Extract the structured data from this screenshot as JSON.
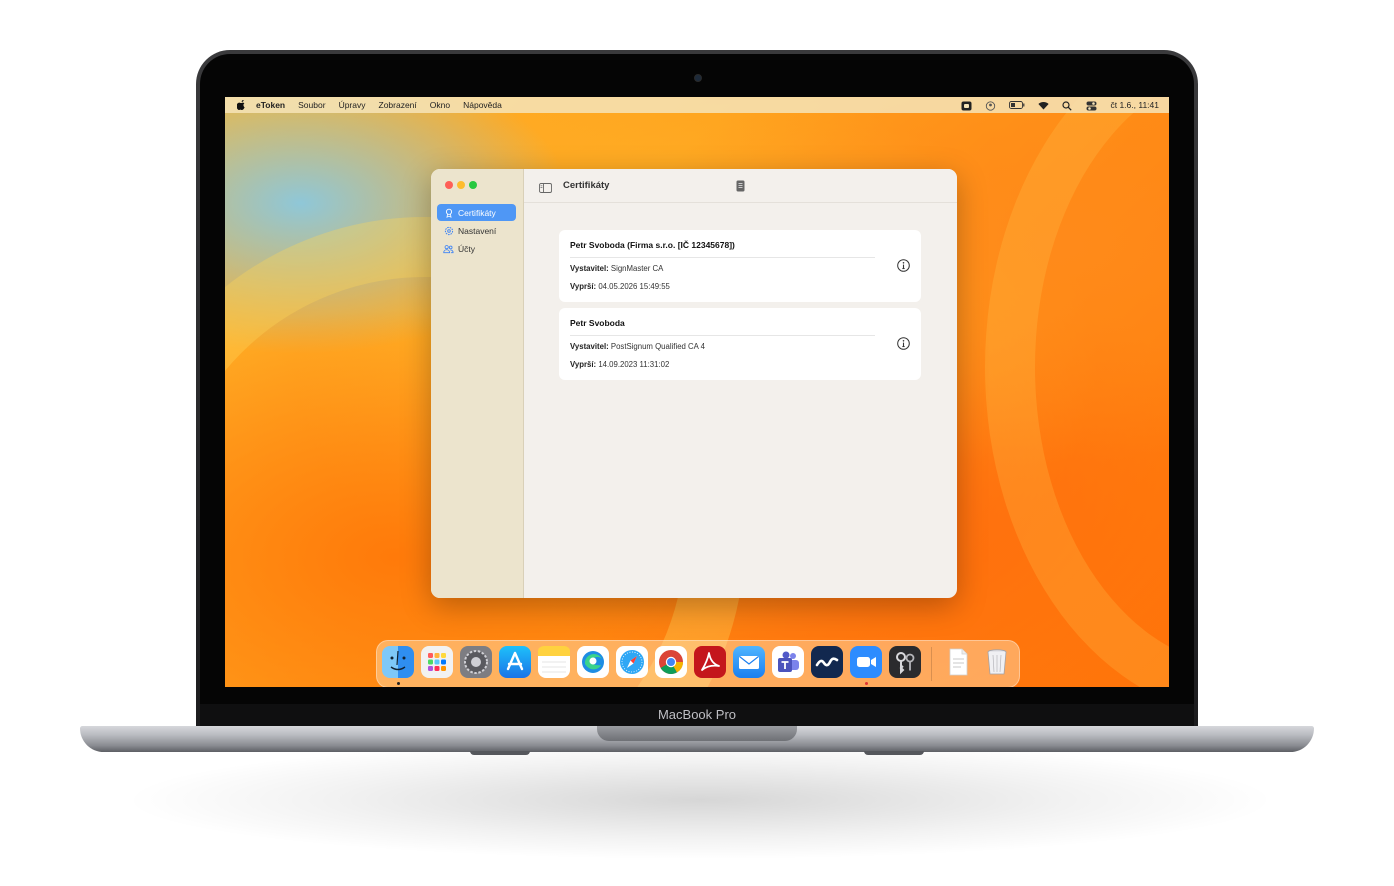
{
  "device": {
    "brand_label": "MacBook Pro"
  },
  "menubar": {
    "app_name": "eToken",
    "menus": [
      "Soubor",
      "Úpravy",
      "Zobrazení",
      "Okno",
      "Nápověda"
    ],
    "clock": "čt 1.6., 11:41",
    "status_icons": [
      "app-status-icon",
      "user-icon",
      "battery-icon",
      "wifi-icon",
      "search-icon",
      "control-center-icon"
    ]
  },
  "window": {
    "title": "Certifikáty",
    "sidebar": {
      "items": [
        {
          "label": "Certifikáty",
          "icon": "certificate-icon",
          "active": true
        },
        {
          "label": "Nastavení",
          "icon": "gear-icon",
          "active": false
        },
        {
          "label": "Účty",
          "icon": "users-icon",
          "active": false
        }
      ]
    },
    "certificates": [
      {
        "name": "Petr Svoboda (Firma s.r.o. [IČ 12345678])",
        "issuer_label": "Vystavitel:",
        "issuer": "SignMaster CA",
        "expires_label": "Vyprší:",
        "expires": "04.05.2026 15:49:55"
      },
      {
        "name": "Petr Svoboda",
        "issuer_label": "Vystavitel:",
        "issuer": "PostSignum Qualified CA 4",
        "expires_label": "Vyprší:",
        "expires": "14.09.2023 11:31:02"
      }
    ]
  },
  "dock": {
    "apps": [
      "finder-icon",
      "launchpad-icon",
      "system-settings-icon",
      "app-store-icon",
      "notes-icon",
      "edge-icon",
      "safari-icon",
      "chrome-icon",
      "acrobat-icon",
      "mail-icon",
      "teams-icon",
      "etoken-icon",
      "zoom-icon",
      "keychain-icon",
      "document-icon",
      "trash-icon"
    ]
  },
  "colors": {
    "accent": "#4f97f5",
    "sidebar_bg": "#ece4cd",
    "content_bg": "#f3f0ec"
  }
}
